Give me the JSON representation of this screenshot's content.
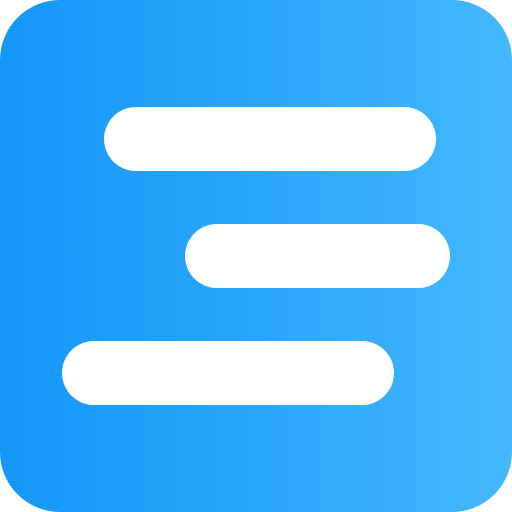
{
  "app_icon": {
    "name": "text-align-lines-icon",
    "colors": {
      "gradient_start": "#1597f8",
      "gradient_end": "#45b8ff",
      "bar": "#ffffff"
    },
    "bars": [
      {
        "name": "top-line"
      },
      {
        "name": "middle-line"
      },
      {
        "name": "bottom-line"
      }
    ]
  }
}
